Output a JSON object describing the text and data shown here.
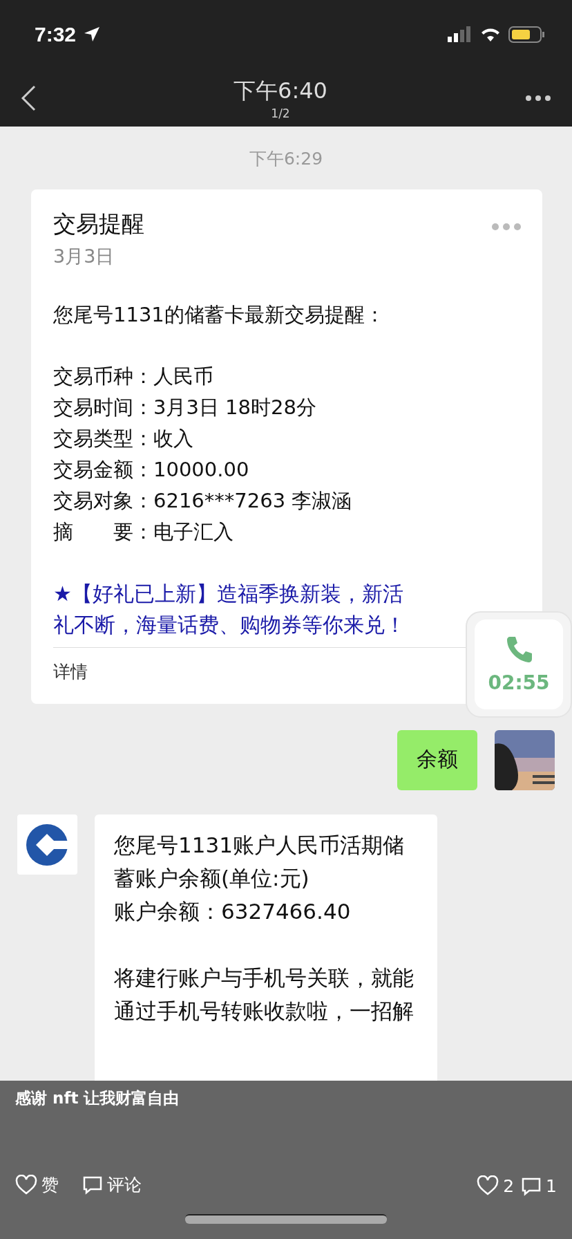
{
  "status_bar": {
    "time": "7:32"
  },
  "nav": {
    "title": "下午6:40",
    "page": "1/2"
  },
  "chat": {
    "timestamp": "下午6:29",
    "card": {
      "title": "交易提醒",
      "date": "3月3日",
      "intro": "您尾号1131的储蓄卡最新交易提醒：",
      "fields": [
        {
          "label": "交易币种：",
          "value": "人民币"
        },
        {
          "label": "交易时间：",
          "value": "3月3日 18时28分"
        },
        {
          "label": "交易类型：",
          "value": "收入"
        },
        {
          "label": "交易金额：",
          "value": "10000.00"
        },
        {
          "label": "交易对象：",
          "value": "6216***7263 李淑涵"
        },
        {
          "label": "摘　　要：",
          "value": "电子汇入"
        }
      ],
      "promo": "★【好礼已上新】造福季换新装，新活礼不断，海量话费、购物券等你来兑！",
      "details": "详情"
    },
    "call": {
      "duration": "02:55"
    },
    "outgoing": {
      "text": "余额"
    },
    "incoming": {
      "paragraphs": [
        "您尾号1131账户人民币活期储蓄账户余额(单位:元)\n账户余额：6327466.40",
        "将建行账户与手机号关联，就能通过手机号转账收款啦，一招解"
      ]
    }
  },
  "overlay": {
    "caption": "感谢 nft 让我财富自由",
    "like": "赞",
    "comment": "评论",
    "likes": "2",
    "comments": "1"
  }
}
